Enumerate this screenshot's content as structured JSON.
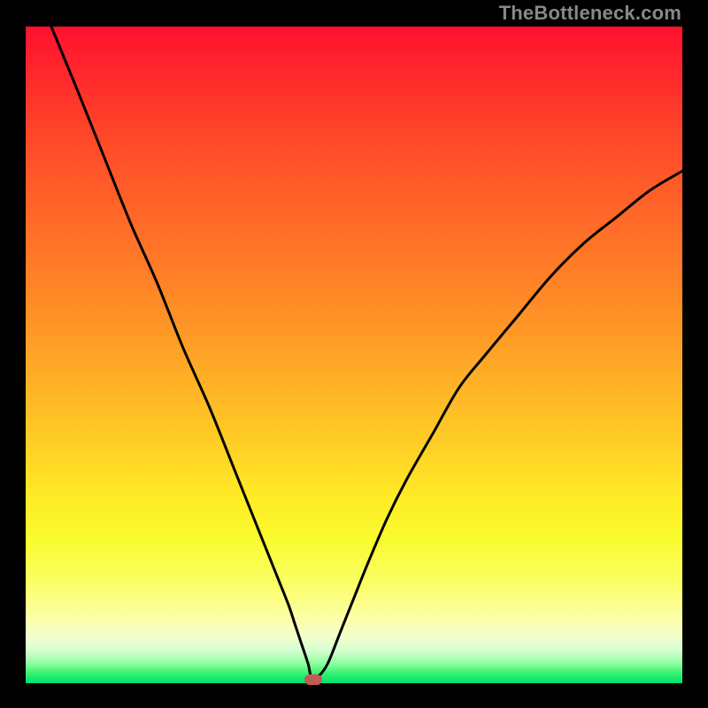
{
  "watermark": "TheBottleneck.com",
  "colors": {
    "frame": "#000000",
    "curve": "#000000",
    "marker": "#c25a5a",
    "gradient_top": "#ff1030",
    "gradient_bottom": "#00e070"
  },
  "chart_data": {
    "type": "line",
    "title": "",
    "xlabel": "",
    "ylabel": "",
    "xlim": [
      0,
      100
    ],
    "ylim": [
      0,
      100
    ],
    "series": [
      {
        "name": "bottleneck-curve",
        "x": [
          3.9,
          8,
          12,
          16,
          20,
          24,
          28,
          32,
          36,
          38,
          40,
          41,
          42,
          43,
          43.5,
          44.5,
          46,
          48,
          50,
          52,
          55,
          58,
          62,
          66,
          70,
          75,
          80,
          85,
          90,
          95,
          100
        ],
        "values": [
          100,
          90,
          80,
          70,
          61,
          51,
          42,
          32,
          22,
          17,
          12,
          9,
          6,
          3,
          1,
          1,
          3,
          8,
          13,
          18,
          25,
          31,
          38,
          45,
          50,
          56,
          62,
          67,
          71,
          75,
          78
        ]
      }
    ],
    "marker": {
      "x": 43.8,
      "y": 0.6
    },
    "annotations": []
  }
}
